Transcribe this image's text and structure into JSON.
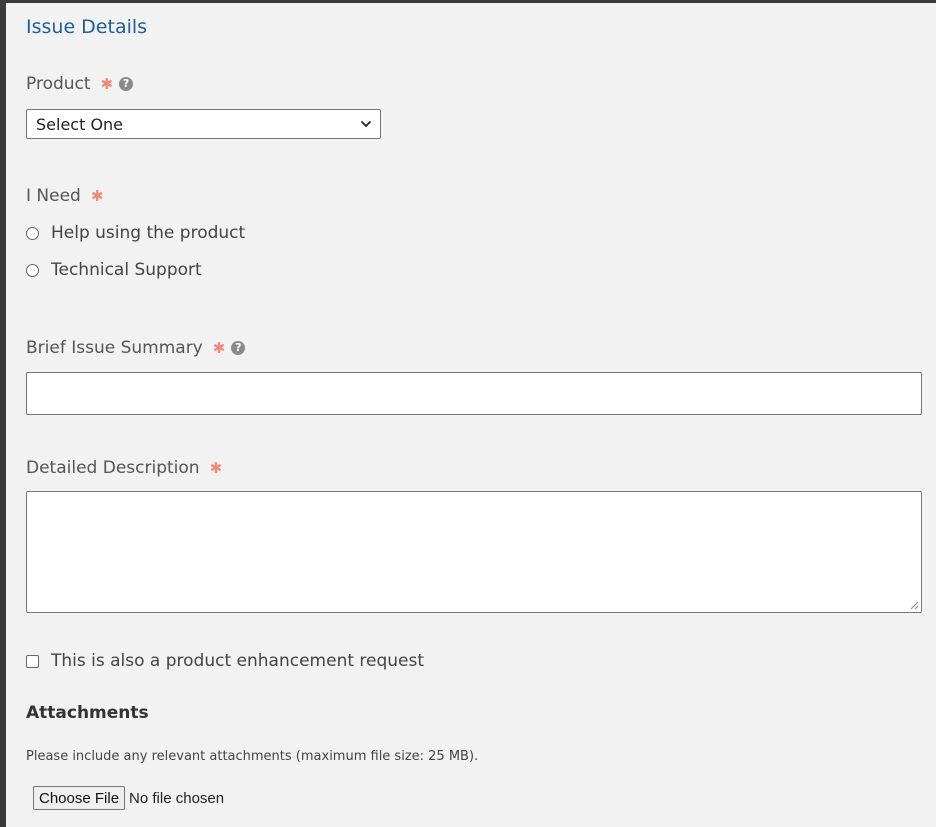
{
  "section": {
    "title": "Issue Details"
  },
  "product": {
    "label": "Product",
    "required_mark": "✱",
    "help_glyph": "?",
    "selected_value": "Select One"
  },
  "need": {
    "label": "I Need",
    "required_mark": "✱",
    "options": [
      {
        "label": "Help using the product",
        "checked": false
      },
      {
        "label": "Technical Support",
        "checked": false
      }
    ]
  },
  "summary": {
    "label": "Brief Issue Summary",
    "required_mark": "✱",
    "help_glyph": "?",
    "value": ""
  },
  "description": {
    "label": "Detailed Description",
    "required_mark": "✱",
    "value": ""
  },
  "enhancement": {
    "label": "This is also a product enhancement request",
    "checked": false
  },
  "attachments": {
    "heading": "Attachments",
    "hint": "Please include any relevant attachments (maximum file size: 25 MB).",
    "button_label": "Choose File",
    "status": "No file chosen"
  },
  "icons": {
    "required": "asterisk-icon",
    "help": "question-circle-icon",
    "dropdown": "chevron-down-icon",
    "resize": "resize-grip-icon"
  },
  "colors": {
    "title": "#1f5f9a",
    "required": "#ef8a7a",
    "background": "#f2f2f2",
    "border": "#767676"
  }
}
